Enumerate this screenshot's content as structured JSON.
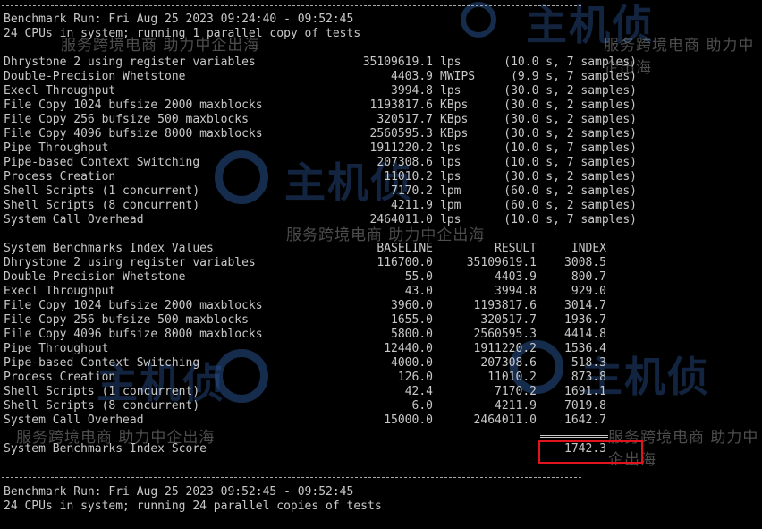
{
  "colors": {
    "background": "#000000",
    "text": "#c8c8c8",
    "highlight": "#e0141e"
  },
  "watermark": {
    "brand_glyphs": "主机侦",
    "slogan": "服务跨境电商 助力中企出海"
  },
  "run1": {
    "header": "Benchmark Run: Fri Aug 25 2023 09:24:40 - 09:52:45",
    "subheader": "24 CPUs in system; running 1 parallel copy of tests"
  },
  "tests": [
    {
      "name": "Dhrystone 2 using register variables",
      "value": "35109619.1",
      "unit": "lps",
      "detail": "(10.0 s, 7 samples)"
    },
    {
      "name": "Double-Precision Whetstone",
      "value": "4403.9",
      "unit": "MWIPS",
      "detail": "(9.9 s, 7 samples)"
    },
    {
      "name": "Execl Throughput",
      "value": "3994.8",
      "unit": "lps",
      "detail": "(30.0 s, 2 samples)"
    },
    {
      "name": "File Copy 1024 bufsize 2000 maxblocks",
      "value": "1193817.6",
      "unit": "KBps",
      "detail": "(30.0 s, 2 samples)"
    },
    {
      "name": "File Copy 256 bufsize 500 maxblocks",
      "value": "320517.7",
      "unit": "KBps",
      "detail": "(30.0 s, 2 samples)"
    },
    {
      "name": "File Copy 4096 bufsize 8000 maxblocks",
      "value": "2560595.3",
      "unit": "KBps",
      "detail": "(30.0 s, 2 samples)"
    },
    {
      "name": "Pipe Throughput",
      "value": "1911220.2",
      "unit": "lps",
      "detail": "(10.0 s, 7 samples)"
    },
    {
      "name": "Pipe-based Context Switching",
      "value": "207308.6",
      "unit": "lps",
      "detail": "(10.0 s, 7 samples)"
    },
    {
      "name": "Process Creation",
      "value": "11010.2",
      "unit": "lps",
      "detail": "(30.0 s, 2 samples)"
    },
    {
      "name": "Shell Scripts (1 concurrent)",
      "value": "7170.2",
      "unit": "lpm",
      "detail": "(60.0 s, 2 samples)"
    },
    {
      "name": "Shell Scripts (8 concurrent)",
      "value": "4211.9",
      "unit": "lpm",
      "detail": "(60.0 s, 2 samples)"
    },
    {
      "name": "System Call Overhead",
      "value": "2464011.0",
      "unit": "lps",
      "detail": "(10.0 s, 7 samples)"
    }
  ],
  "index_table": {
    "title": "System Benchmarks Index Values",
    "headers": {
      "baseline": "BASELINE",
      "result": "RESULT",
      "index": "INDEX"
    },
    "rows": [
      {
        "name": "Dhrystone 2 using register variables",
        "baseline": "116700.0",
        "result": "35109619.1",
        "index": "3008.5"
      },
      {
        "name": "Double-Precision Whetstone",
        "baseline": "55.0",
        "result": "4403.9",
        "index": "800.7"
      },
      {
        "name": "Execl Throughput",
        "baseline": "43.0",
        "result": "3994.8",
        "index": "929.0"
      },
      {
        "name": "File Copy 1024 bufsize 2000 maxblocks",
        "baseline": "3960.0",
        "result": "1193817.6",
        "index": "3014.7"
      },
      {
        "name": "File Copy 256 bufsize 500 maxblocks",
        "baseline": "1655.0",
        "result": "320517.7",
        "index": "1936.7"
      },
      {
        "name": "File Copy 4096 bufsize 8000 maxblocks",
        "baseline": "5800.0",
        "result": "2560595.3",
        "index": "4414.8"
      },
      {
        "name": "Pipe Throughput",
        "baseline": "12440.0",
        "result": "1911220.2",
        "index": "1536.4"
      },
      {
        "name": "Pipe-based Context Switching",
        "baseline": "4000.0",
        "result": "207308.6",
        "index": "518.3"
      },
      {
        "name": "Process Creation",
        "baseline": "126.0",
        "result": "11010.2",
        "index": "873.8"
      },
      {
        "name": "Shell Scripts (1 concurrent)",
        "baseline": "42.4",
        "result": "7170.2",
        "index": "1691.1"
      },
      {
        "name": "Shell Scripts (8 concurrent)",
        "baseline": "6.0",
        "result": "4211.9",
        "index": "7019.8"
      },
      {
        "name": "System Call Overhead",
        "baseline": "15000.0",
        "result": "2464011.0",
        "index": "1642.7"
      }
    ],
    "score_label": "System Benchmarks Index Score",
    "score": "1742.3"
  },
  "run2": {
    "header": "Benchmark Run: Fri Aug 25 2023 09:52:45 - 09:52:45",
    "subheader": "24 CPUs in system; running 24 parallel copies of tests"
  }
}
